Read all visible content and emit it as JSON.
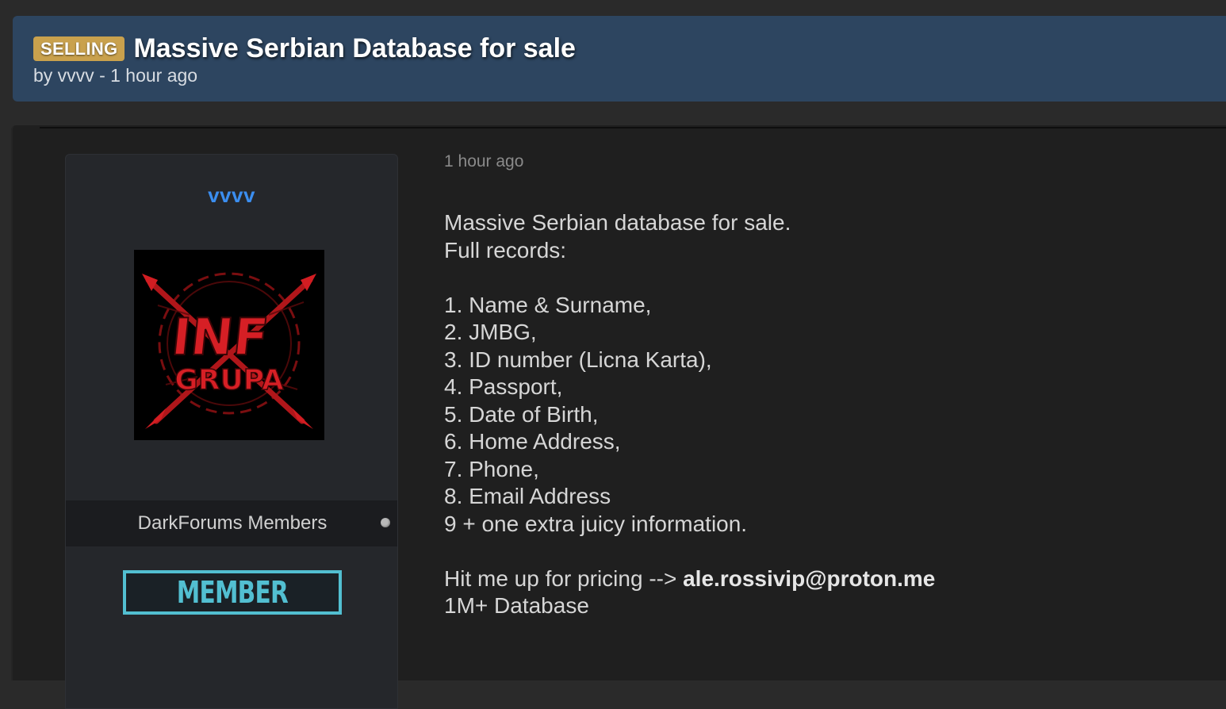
{
  "header": {
    "prefix": "SELLING",
    "title": "Massive Serbian Database for sale",
    "byline": "by vvvv - 1 hour ago"
  },
  "author": {
    "username": "vvvv",
    "avatar_text_top": "INF",
    "avatar_text_bottom": "GRUPA",
    "usergroup": "DarkForums Members",
    "rank_badge": "MEMBER"
  },
  "post": {
    "time": "1 hour ago",
    "intro": [
      "Massive Serbian database for sale.",
      "Full records:"
    ],
    "records": [
      "1. Name & Surname,",
      "2. JMBG,",
      "3. ID number (Licna Karta),",
      "4. Passport,",
      "5. Date of Birth,",
      "6. Home Address,",
      "7. Phone,",
      "8. Email Address",
      "9 + one extra juicy information."
    ],
    "contact_prefix": "Hit me up for pricing --> ",
    "contact_email": "ale.rossivip@proton.me",
    "footer": "1M+ Database"
  },
  "colors": {
    "header_bg": "#2d4560",
    "prefix_badge": "#c9a14d",
    "username": "#3b8ef0",
    "rank_badge": "#52bfd1",
    "avatar_red": "#c0181b"
  }
}
